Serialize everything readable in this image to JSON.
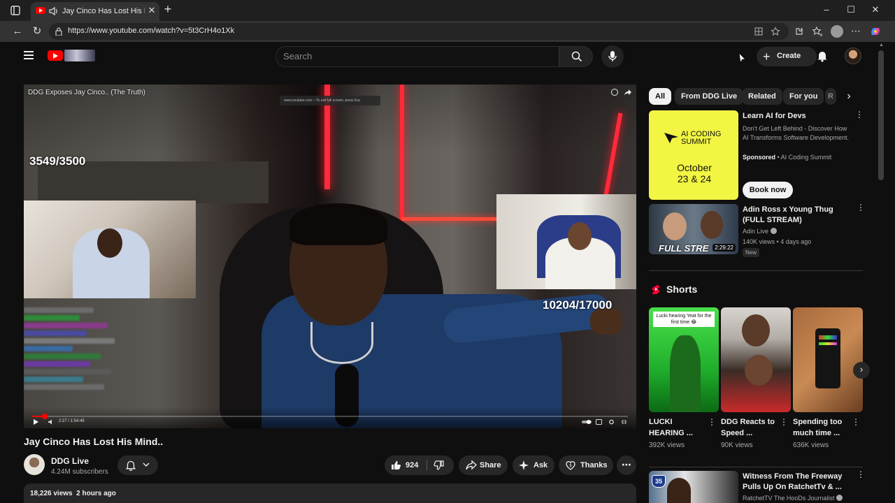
{
  "browser": {
    "tab_title": "Jay Cinco Has Lost His Mind..",
    "url": "https://www.youtube.com/watch?v=5t3CrH4o1Xk"
  },
  "header": {
    "search_placeholder": "Search",
    "create_label": "Create"
  },
  "player": {
    "overlay_title": "DDG Exposes Jay Cinco.. (The Truth)",
    "overlay_hint": "www.youtube.com – To exit full screen, press Esc",
    "counter_left": "3549/3500",
    "counter_right": "10204/17000",
    "time": "2:27 / 1:54:45",
    "progress_fraction": 0.021
  },
  "video": {
    "title": "Jay Cinco Has Lost His Mind..",
    "channel_name": "DDG Live",
    "subscribers": "4.24M subscribers",
    "likes": "924",
    "share_label": "Share",
    "ask_label": "Ask",
    "thanks_label": "Thanks",
    "views": "18,226 views",
    "posted": "2 hours ago"
  },
  "sidebar": {
    "chips": [
      "All",
      "From DDG Live",
      "Related",
      "For you",
      "R"
    ],
    "ad": {
      "thumb_line1": "AI CODING",
      "thumb_line2": "SUMMIT",
      "thumb_date": "October 23 & 24",
      "title": "Learn AI for Devs",
      "description": "Don't Get Left Behind - Discover How AI Transforms Software Development.",
      "sponsored": "Sponsored",
      "advertiser": "AI Coding Summit",
      "cta": "Book now"
    },
    "rec1": {
      "title": "Adin Ross x Young Thug (FULL STREAM)",
      "channel": "Adin Live",
      "views": "140K views",
      "age": "4 days ago",
      "badge": "New",
      "thumb_text": "FULL STRE",
      "duration": "2:29:22"
    },
    "shorts_label": "Shorts",
    "shorts": [
      {
        "title": "LUCKI HEARING ...",
        "views": "392K views",
        "caption": "Lucki hearing Yeat for the first time 😂"
      },
      {
        "title": "DDG Reacts to Speed ...",
        "views": "90K views"
      },
      {
        "title": "Spending too much time ...",
        "views": "636K views"
      }
    ],
    "rec2": {
      "title": "Witness From The Freeway Pulls Up On RatchetTv & ...",
      "channel": "RatchetTV The HooDs Journalist",
      "shield": "35"
    }
  },
  "colors": {
    "brand_red": "#ff0000",
    "background": "#0f0f0f",
    "surface": "#272727",
    "ad_yellow": "#f2f542"
  }
}
